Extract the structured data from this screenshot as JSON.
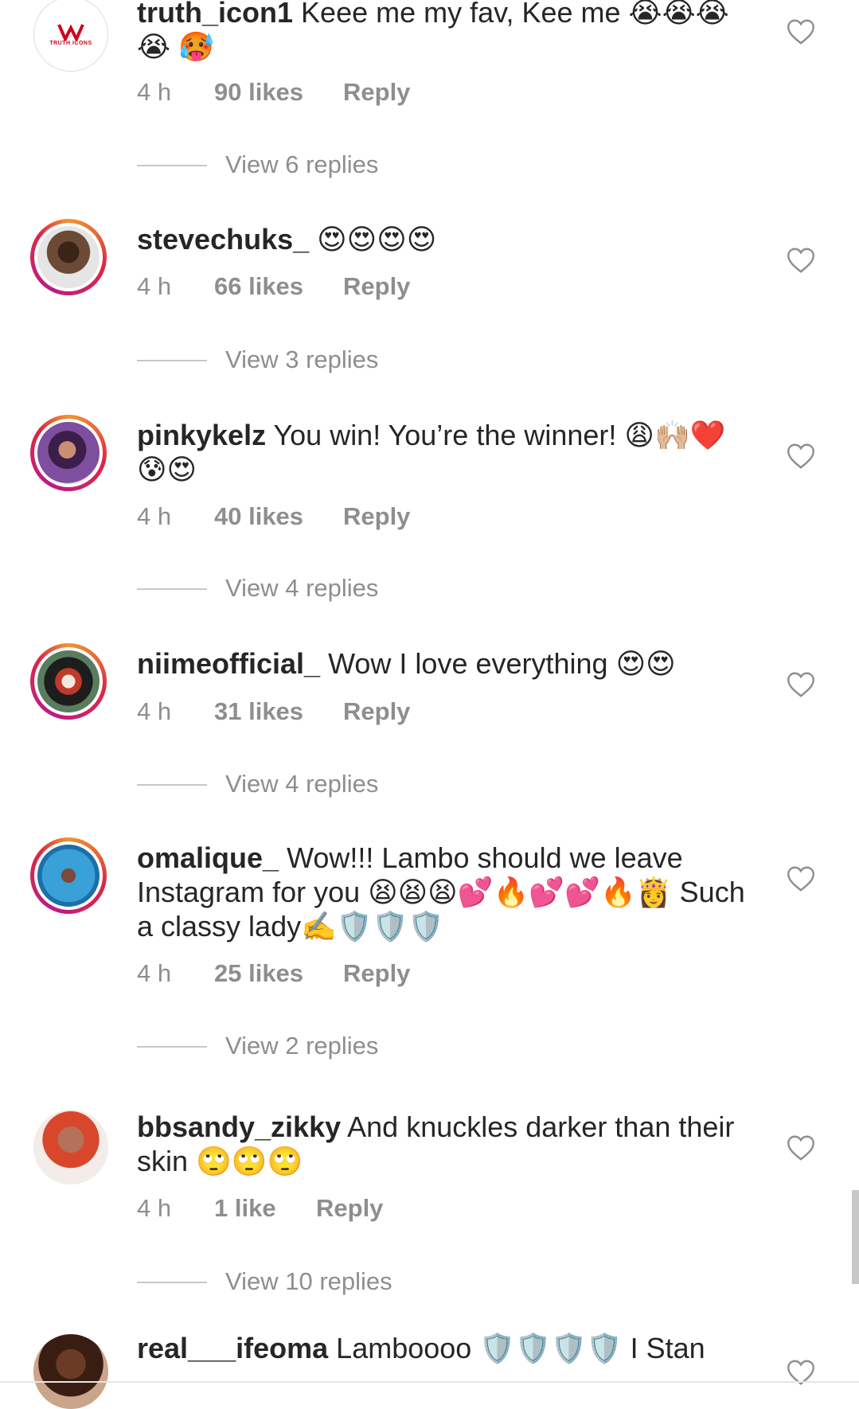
{
  "comments": [
    {
      "username": "truth_icon1",
      "text": "Keee me my fav, Kee me 😭😭😭😭 🥵",
      "time": "4 h",
      "likes": "90 likes",
      "reply": "Reply",
      "view_replies": "View 6 replies",
      "avatar_style": "plain",
      "avatar_logo_text": "TRUTH ICONS"
    },
    {
      "username": "stevechuks_",
      "text": "😍😍😍😍",
      "time": "4 h",
      "likes": "66 likes",
      "reply": "Reply",
      "view_replies": "View 3 replies",
      "avatar_style": "ring"
    },
    {
      "username": "pinkykelz",
      "text": "You win! You’re the winner! 😩🙌🏼❤️ 😰😍",
      "time": "4 h",
      "likes": "40 likes",
      "reply": "Reply",
      "view_replies": "View 4 replies",
      "avatar_style": "ring"
    },
    {
      "username": "niimeofficial_",
      "text": "Wow I love everything 😍😍",
      "time": "4 h",
      "likes": "31 likes",
      "reply": "Reply",
      "view_replies": "View 4 replies",
      "avatar_style": "ring"
    },
    {
      "username": "omalique_",
      "text": "Wow!!! Lambo should we leave Instagram for you 😫😫😫💕🔥💕💕🔥👸 Such a classy lady✍️🛡️🛡️🛡️",
      "time": "4 h",
      "likes": "25 likes",
      "reply": "Reply",
      "view_replies": "View 2 replies",
      "avatar_style": "ring"
    },
    {
      "username": "bbsandy_zikky",
      "text": "And knuckles darker than their skin 🙄🙄🙄",
      "time": "4 h",
      "likes": "1 like",
      "reply": "Reply",
      "view_replies": "View 10 replies",
      "avatar_style": "plain"
    },
    {
      "username": "real___ifeoma",
      "text": "Lamboooo 🛡️🛡️🛡️🛡️ I Stan",
      "avatar_style": "plain"
    }
  ],
  "icons": {
    "like": "heart-outline-icon"
  },
  "colors": {
    "text": "#262626",
    "secondary": "#8e8e8e",
    "story_ring_start": "#f09433",
    "story_ring_end": "#bc1888"
  }
}
